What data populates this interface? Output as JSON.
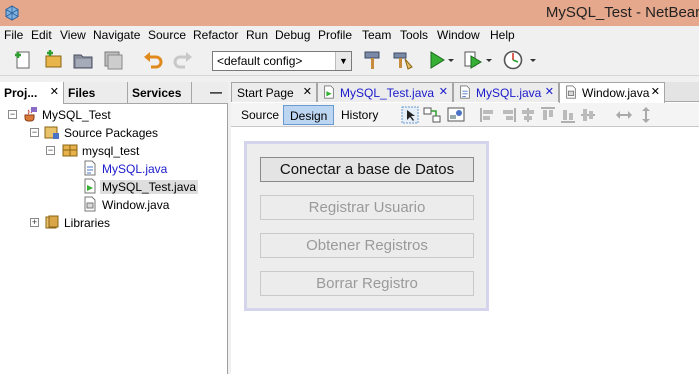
{
  "window": {
    "title": "MySQL_Test - NetBeans"
  },
  "menu": [
    "File",
    "Edit",
    "View",
    "Navigate",
    "Source",
    "Refactor",
    "Run",
    "Debug",
    "Profile",
    "Team",
    "Tools",
    "Window",
    "Help"
  ],
  "toolbar": {
    "config": "<default config>"
  },
  "left_panel": {
    "tabs": [
      "Proj...",
      "Files",
      "Services"
    ],
    "minimize": "—",
    "tree": {
      "project": "MySQL_Test",
      "source_packages": "Source Packages",
      "package": "mysql_test",
      "files": [
        "MySQL.java",
        "MySQL_Test.java",
        "Window.java"
      ],
      "libraries": "Libraries"
    }
  },
  "editor": {
    "tabs": [
      "Start Page",
      "MySQL_Test.java",
      "MySQL.java",
      "Window.java"
    ],
    "views": [
      "Source",
      "Design",
      "History"
    ],
    "active_view": "Design"
  },
  "form": {
    "buttons": [
      {
        "label": "Conectar a base de Datos",
        "enabled": true
      },
      {
        "label": "Registrar Usuario",
        "enabled": false
      },
      {
        "label": "Obtener Registros",
        "enabled": false
      },
      {
        "label": "Borrar Registro",
        "enabled": false
      }
    ]
  },
  "colors": {
    "titlebar": "#e6a88c",
    "design_active": "#bcd6f1",
    "form_border": "#d4d4ec"
  }
}
